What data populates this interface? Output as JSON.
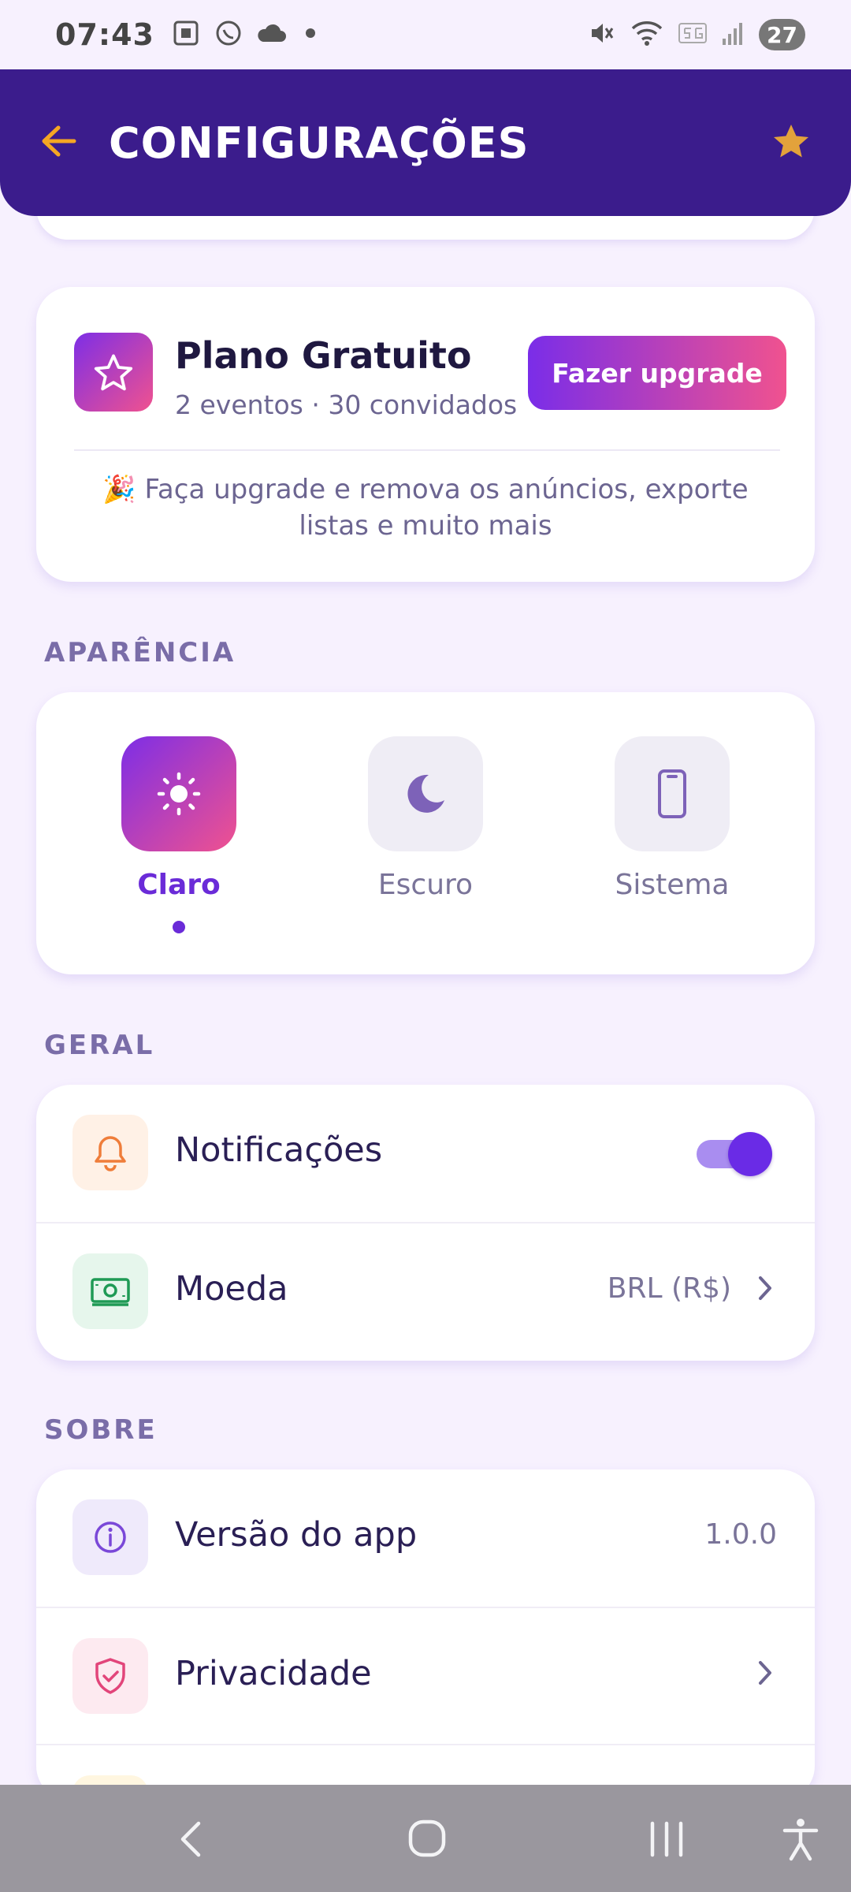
{
  "status_bar": {
    "time": "07:43",
    "battery": "27",
    "icons": [
      "screenshot-icon",
      "whatsapp-icon",
      "cloud-icon",
      "dot-icon",
      "mute-icon",
      "wifi-icon",
      "5g-icon",
      "signal-icon",
      "battery-icon"
    ]
  },
  "header": {
    "title": "CONFIGURAÇÕES",
    "back_icon": "arrow-left-icon",
    "star_icon": "star-icon",
    "colors": {
      "background": "#3b1c8c",
      "accent": "#f0a030"
    }
  },
  "plan": {
    "name": "Plano Gratuito",
    "details": "2 eventos · 30 convidados",
    "upgrade_label": "Fazer upgrade",
    "promo": "🎉 Faça upgrade e remova os anúncios, exporte listas e muito mais"
  },
  "appearance": {
    "section_label": "APARÊNCIA",
    "options": [
      {
        "label": "Claro",
        "icon": "sun-icon",
        "selected": true
      },
      {
        "label": "Escuro",
        "icon": "moon-icon",
        "selected": false
      },
      {
        "label": "Sistema",
        "icon": "phone-icon",
        "selected": false
      }
    ]
  },
  "general": {
    "section_label": "GERAL",
    "notifications": {
      "label": "Notificações",
      "enabled": true,
      "icon": "bell-icon"
    },
    "currency": {
      "label": "Moeda",
      "value": "BRL (R$)",
      "icon": "money-icon"
    }
  },
  "about": {
    "section_label": "SOBRE",
    "version": {
      "label": "Versão do app",
      "value": "1.0.0",
      "icon": "info-icon"
    },
    "privacy": {
      "label": "Privacidade",
      "icon": "shield-icon"
    }
  },
  "nav": {
    "icons": [
      "back-icon",
      "home-icon",
      "recents-icon",
      "accessibility-icon"
    ]
  }
}
